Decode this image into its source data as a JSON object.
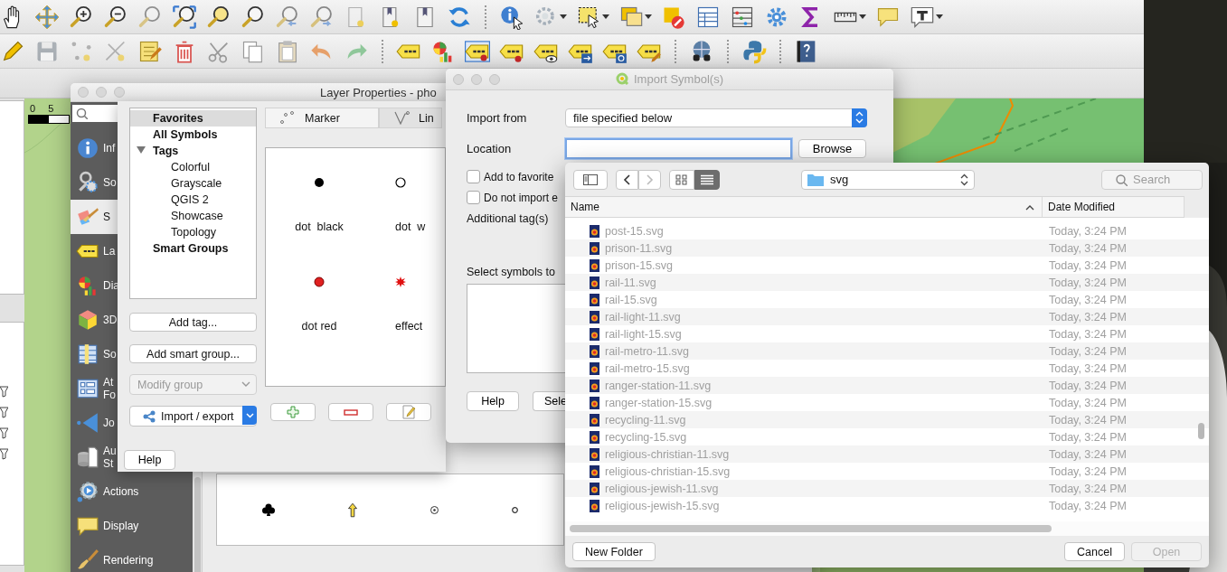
{
  "map": {
    "scale_labels": [
      "0",
      "5"
    ]
  },
  "layer_properties": {
    "title": "Layer Properties - pho",
    "sidebar": [
      {
        "label": "Inf",
        "selected": false
      },
      {
        "label": "So",
        "selected": false
      },
      {
        "label": "S",
        "selected": true
      },
      {
        "label": "La",
        "selected": false
      },
      {
        "label": "Dia",
        "selected": false
      },
      {
        "label": "3D",
        "selected": false
      },
      {
        "label": "So",
        "selected": false
      },
      {
        "label": "At Fo",
        "selected": false
      },
      {
        "label": "Jo",
        "selected": false
      },
      {
        "label": "Au St",
        "selected": false
      },
      {
        "label": "Actions",
        "selected": false
      },
      {
        "label": "Display",
        "selected": false
      },
      {
        "label": "Rendering",
        "selected": false
      }
    ]
  },
  "style_manager": {
    "tree": [
      {
        "label": "Favorites",
        "selected": true
      },
      {
        "label": "All Symbols",
        "selected": false
      },
      {
        "label": "Tags",
        "selected": false,
        "expanded": true,
        "children": [
          {
            "label": "Colorful",
            "selected": false
          },
          {
            "label": "Grayscale",
            "selected": false
          },
          {
            "label": "QGIS 2",
            "selected": false
          },
          {
            "label": "Showcase",
            "selected": false
          },
          {
            "label": "Topology",
            "selected": false
          }
        ]
      },
      {
        "label": "Smart Groups",
        "selected": false
      }
    ],
    "buttons": [
      "Add tag...",
      "Add smart group..."
    ],
    "group_select": {
      "value": "Modify group",
      "disabled": true
    },
    "import_export": "Import / export",
    "help": "Help",
    "tabs": [
      {
        "label": "Marker",
        "kind": "marker",
        "selected": true
      },
      {
        "label": "Lin",
        "kind": "line",
        "selected": false
      }
    ],
    "symbols": [
      {
        "name": "dot  black",
        "kind": "dot-black"
      },
      {
        "name": "dot  w",
        "kind": "dot-white"
      },
      {
        "name": "dot red",
        "kind": "dot-red"
      },
      {
        "name": "effect",
        "kind": "star-red"
      }
    ]
  },
  "import_dialog": {
    "title": "Import Symbol(s)",
    "import_from_label": "Import from",
    "import_from": "file specified below",
    "location_label": "Location",
    "location_focused": true,
    "browse": "Browse",
    "checkboxes": [
      {
        "label": "Add to favorite",
        "checked": false
      },
      {
        "label": "Do not import e",
        "checked": false
      }
    ],
    "tags_label": "Additional tag(s)",
    "select_label": "Select symbols to",
    "buttons": [
      "Help",
      "Sele"
    ]
  },
  "file_dialog": {
    "folder": "svg",
    "search_placeholder": "Search",
    "nav": [
      {
        "kind": "back",
        "disabled": false
      },
      {
        "kind": "forward",
        "disabled": true
      }
    ],
    "views": [
      {
        "kind": "icons",
        "selected": false
      },
      {
        "kind": "list",
        "selected": true
      }
    ],
    "columns": [
      {
        "label": "Name",
        "sorted": true
      },
      {
        "label": "Date Modified",
        "sorted": false
      }
    ],
    "files": [
      {
        "name": "post-15.svg",
        "modified": "Today, 3:24 PM"
      },
      {
        "name": "prison-11.svg",
        "modified": "Today, 3:24 PM"
      },
      {
        "name": "prison-15.svg",
        "modified": "Today, 3:24 PM"
      },
      {
        "name": "rail-11.svg",
        "modified": "Today, 3:24 PM"
      },
      {
        "name": "rail-15.svg",
        "modified": "Today, 3:24 PM"
      },
      {
        "name": "rail-light-11.svg",
        "modified": "Today, 3:24 PM"
      },
      {
        "name": "rail-light-15.svg",
        "modified": "Today, 3:24 PM"
      },
      {
        "name": "rail-metro-11.svg",
        "modified": "Today, 3:24 PM"
      },
      {
        "name": "rail-metro-15.svg",
        "modified": "Today, 3:24 PM"
      },
      {
        "name": "ranger-station-11.svg",
        "modified": "Today, 3:24 PM"
      },
      {
        "name": "ranger-station-15.svg",
        "modified": "Today, 3:24 PM"
      },
      {
        "name": "recycling-11.svg",
        "modified": "Today, 3:24 PM"
      },
      {
        "name": "recycling-15.svg",
        "modified": "Today, 3:24 PM"
      },
      {
        "name": "religious-christian-11.svg",
        "modified": "Today, 3:24 PM"
      },
      {
        "name": "religious-christian-15.svg",
        "modified": "Today, 3:24 PM"
      },
      {
        "name": "religious-jewish-11.svg",
        "modified": "Today, 3:24 PM"
      },
      {
        "name": "religious-jewish-15.svg",
        "modified": "Today, 3:24 PM"
      }
    ],
    "buttons": [
      {
        "label": "New Folder",
        "disabled": false
      },
      {
        "label": "Cancel",
        "disabled": false
      },
      {
        "label": "Open",
        "disabled": true
      }
    ]
  }
}
